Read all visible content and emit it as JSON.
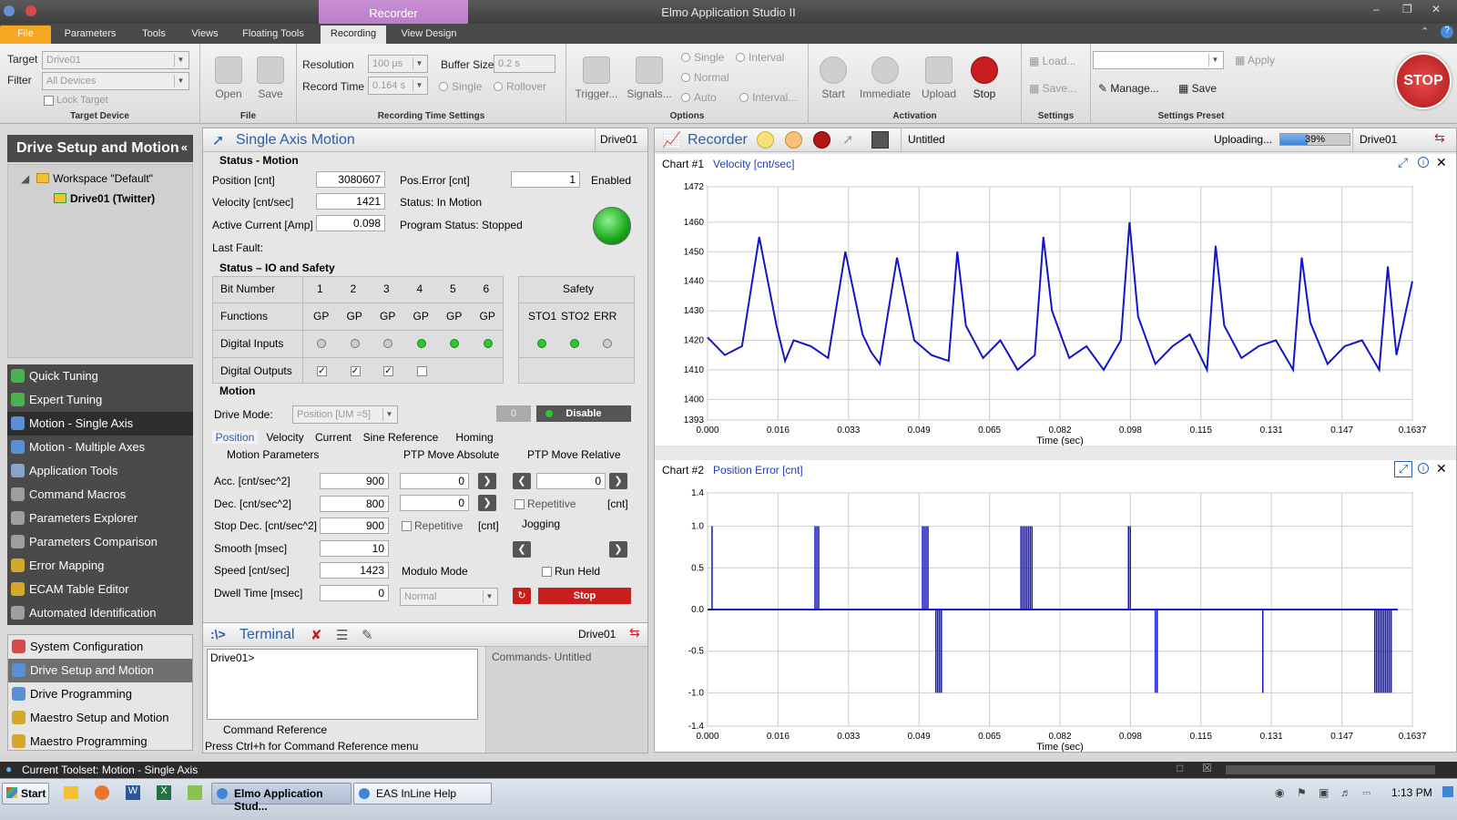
{
  "app": {
    "title": "Elmo Application Studio II",
    "context_tab": "Recorder",
    "menu_tabs": [
      "File",
      "Parameters",
      "Tools",
      "Views",
      "Floating Tools",
      "Recording",
      "View Design"
    ]
  },
  "ribbon": {
    "target_label": "Target",
    "target_value": "Drive01",
    "filter_label": "Filter",
    "filter_value": "All Devices",
    "lock_target": "Lock Target",
    "group_target_device": "Target Device",
    "open": "Open",
    "save": "Save",
    "group_file": "File",
    "resolution_label": "Resolution",
    "resolution_value": "100 µs",
    "buffer_size_label": "Buffer Size",
    "buffer_size_value": "0.2 s",
    "record_time_label": "Record Time",
    "record_time_value": "0.164 s",
    "single": "Single",
    "rollover": "Rollover",
    "group_recording_time": "Recording Time Settings",
    "trigger": "Trigger...",
    "signals": "Signals...",
    "opt_single": "Single",
    "opt_interval": "Interval",
    "opt_normal": "Normal",
    "opt_auto": "Auto",
    "opt_interval_btn": "Interval...",
    "group_options": "Options",
    "start": "Start",
    "immediate": "Immediate",
    "upload": "Upload",
    "stop": "Stop",
    "group_activation": "Activation",
    "load": "Load...",
    "save_settings": "Save...",
    "group_settings": "Settings",
    "apply": "Apply",
    "manage": "Manage...",
    "save_preset": "Save",
    "group_settings_preset": "Settings Preset",
    "stop_big": "STOP"
  },
  "left": {
    "header": "Drive Setup and Motion",
    "workspace": "Workspace \"Default\"",
    "drive": "Drive01 (Twitter)",
    "tools": [
      {
        "label": "Quick Tuning",
        "color": "#4caf50"
      },
      {
        "label": "Expert Tuning",
        "color": "#4caf50"
      },
      {
        "label": "Motion - Single Axis",
        "color": "#5a8fd6"
      },
      {
        "label": "Motion - Multiple Axes",
        "color": "#5a8fd6"
      },
      {
        "label": "Application Tools",
        "color": "#8aa4c8"
      },
      {
        "label": "Command Macros",
        "color": "#9e9e9e"
      },
      {
        "label": "Parameters Explorer",
        "color": "#9e9e9e"
      },
      {
        "label": "Parameters Comparison",
        "color": "#9e9e9e"
      },
      {
        "label": "Error Mapping",
        "color": "#d4a82a"
      },
      {
        "label": "ECAM Table Editor",
        "color": "#d4a82a"
      },
      {
        "label": "Automated Identification",
        "color": "#9e9e9e"
      }
    ],
    "toolsets": [
      {
        "label": "System Configuration",
        "color": "#d64a4a"
      },
      {
        "label": "Drive Setup and Motion",
        "color": "#5a8fd6"
      },
      {
        "label": "Drive Programming",
        "color": "#5a8fd6"
      },
      {
        "label": "Maestro Setup and Motion",
        "color": "#d4a82a"
      },
      {
        "label": "Maestro Programming",
        "color": "#d4a82a"
      }
    ]
  },
  "motion": {
    "title": "Single Axis Motion",
    "drive": "Drive01",
    "status_motion": "Status - Motion",
    "position_label": "Position  [cnt]",
    "position_value": "3080607",
    "velocity_label": "Velocity  [cnt/sec]",
    "velocity_value": "1421",
    "current_label": "Active Current [Amp]",
    "current_value": "0.098",
    "last_fault": "Last Fault:",
    "pos_error_label": "Pos.Error   [cnt]",
    "pos_error_value": "1",
    "enabled": "Enabled",
    "status_text": "Status: In Motion",
    "program_status": "Program Status:  Stopped",
    "status_io": "Status – IO and Safety",
    "bit_number": "Bit Number",
    "bits": [
      "1",
      "2",
      "3",
      "4",
      "5",
      "6"
    ],
    "functions_label": "Functions",
    "functions": [
      "GP",
      "GP",
      "GP",
      "GP",
      "GP",
      "GP"
    ],
    "digital_inputs": "Digital Inputs",
    "inputs_on": [
      false,
      false,
      false,
      true,
      true,
      true
    ],
    "digital_outputs": "Digital Outputs",
    "outputs_checked": [
      true,
      true,
      true,
      false
    ],
    "safety": "Safety",
    "safety_cols": [
      "STO1",
      "STO2",
      "ERR"
    ],
    "safety_on": [
      true,
      true,
      false
    ],
    "motion_head": "Motion",
    "drive_mode_label": "Drive Mode:",
    "drive_mode_value": "Position [UM =5]",
    "zero_btn": "0",
    "disable_btn": "Disable",
    "tabs": [
      "Position",
      "Velocity",
      "Current",
      "Sine Reference",
      "Homing"
    ],
    "motion_params": "Motion Parameters",
    "ptp_abs": "PTP Move Absolute",
    "ptp_rel": "PTP Move Relative",
    "params": [
      {
        "label": "Acc. [cnt/sec^2]",
        "value": "900"
      },
      {
        "label": "Dec. [cnt/sec^2]",
        "value": "800"
      },
      {
        "label": "Stop Dec. [cnt/sec^2]",
        "value": "900"
      },
      {
        "label": "Smooth [msec]",
        "value": "10"
      },
      {
        "label": "Speed [cnt/sec]",
        "value": "1423"
      },
      {
        "label": "Dwell Time [msec]",
        "value": "0"
      }
    ],
    "abs_val1": "0",
    "abs_val2": "0",
    "rel_val": "0",
    "repetitive": "Repetitive",
    "cnt": "[cnt]",
    "jogging": "Jogging",
    "run_held": "Run Held",
    "modulo_mode": "Modulo Mode",
    "modulo_value": "Normal",
    "stop_btn": "Stop"
  },
  "terminal": {
    "title": "Terminal",
    "drive": "Drive01",
    "prompt": "Drive01>",
    "commands": "Commands- Untitled",
    "command_ref": "Command Reference",
    "help": "Press Ctrl+h for Command Reference menu"
  },
  "recorder": {
    "title": "Recorder",
    "file": "Untitled",
    "uploading": "Uploading...",
    "progress_label": "39%",
    "progress": 0.39,
    "drive": "Drive01",
    "series_color": "#1414c8",
    "chart1_title": "Chart #1",
    "chart1_signal": "Velocity [cnt/sec]",
    "chart2_title": "Chart #2",
    "chart2_signal": "Position Error [cnt]",
    "xlabel": "Time (sec)"
  },
  "chart_data": [
    {
      "type": "line",
      "title": "Chart #1",
      "series": [
        {
          "name": "Velocity [cnt/sec]",
          "x": [
            0.0,
            0.004,
            0.008,
            0.012,
            0.016,
            0.018,
            0.02,
            0.024,
            0.028,
            0.032,
            0.036,
            0.038,
            0.04,
            0.044,
            0.048,
            0.052,
            0.056,
            0.058,
            0.06,
            0.064,
            0.068,
            0.072,
            0.076,
            0.078,
            0.08,
            0.084,
            0.088,
            0.092,
            0.096,
            0.098,
            0.1,
            0.104,
            0.108,
            0.112,
            0.116,
            0.118,
            0.12,
            0.124,
            0.128,
            0.132,
            0.136,
            0.138,
            0.14,
            0.144,
            0.148,
            0.152,
            0.156,
            0.158,
            0.16,
            0.1637
          ],
          "y": [
            1421,
            1415,
            1418,
            1455,
            1425,
            1413,
            1420,
            1418,
            1414,
            1450,
            1422,
            1416,
            1412,
            1448,
            1420,
            1415,
            1413,
            1450,
            1425,
            1414,
            1420,
            1410,
            1415,
            1455,
            1430,
            1414,
            1418,
            1410,
            1420,
            1460,
            1428,
            1412,
            1418,
            1422,
            1410,
            1452,
            1425,
            1414,
            1418,
            1420,
            1410,
            1448,
            1426,
            1412,
            1418,
            1420,
            1410,
            1445,
            1415,
            1440
          ]
        }
      ],
      "xlabel": "Time (sec)",
      "ylabel": "",
      "xlim": [
        0,
        0.1637
      ],
      "ylim": [
        1393,
        1472
      ],
      "xticks": [
        "0.000",
        "0.016",
        "0.033",
        "0.049",
        "0.065",
        "0.082",
        "0.098",
        "0.115",
        "0.131",
        "0.147",
        "0.1637"
      ],
      "yticks": [
        "1393",
        "1400",
        "1410",
        "1420",
        "1430",
        "1440",
        "1450",
        "1460",
        "1472"
      ],
      "grid": true
    },
    {
      "type": "line",
      "title": "Chart #2",
      "series": [
        {
          "name": "Position Error [cnt]",
          "pulses": [
            {
              "t": 0.0005,
              "v": 1,
              "n": 1
            },
            {
              "t": 0.012,
              "v": 1,
              "n": 3
            },
            {
              "t": 0.024,
              "v": 1,
              "n": 4
            },
            {
              "t": 0.0255,
              "v": -1,
              "n": 4
            },
            {
              "t": 0.035,
              "v": 1,
              "n": 7
            },
            {
              "t": 0.047,
              "v": 1,
              "n": 2
            },
            {
              "t": 0.05,
              "v": -1,
              "n": 2
            },
            {
              "t": 0.062,
              "v": -1,
              "n": 1
            },
            {
              "t": 0.0745,
              "v": -1,
              "n": 10
            }
          ]
        }
      ],
      "xlabel": "Time (sec)",
      "ylabel": "",
      "xlim": [
        0,
        0.0787
      ],
      "ylim": [
        -1.4,
        1.4
      ],
      "xticks": [
        "0.000",
        "0.016",
        "0.033",
        "0.049",
        "0.065",
        "0.082",
        "0.098",
        "0.115",
        "0.131",
        "0.147",
        "0.1637"
      ],
      "yticks": [
        "1.4",
        "1.0",
        "0.5",
        "0.0",
        "-0.5",
        "-1.0",
        "-1.4"
      ],
      "grid": true
    }
  ],
  "status": {
    "current_toolset": "Current Toolset: Motion - Single Axis"
  },
  "taskbar": {
    "start": "Start",
    "task1": "Elmo Application Stud...",
    "task2": "EAS InLine Help",
    "time": "1:13 PM"
  }
}
